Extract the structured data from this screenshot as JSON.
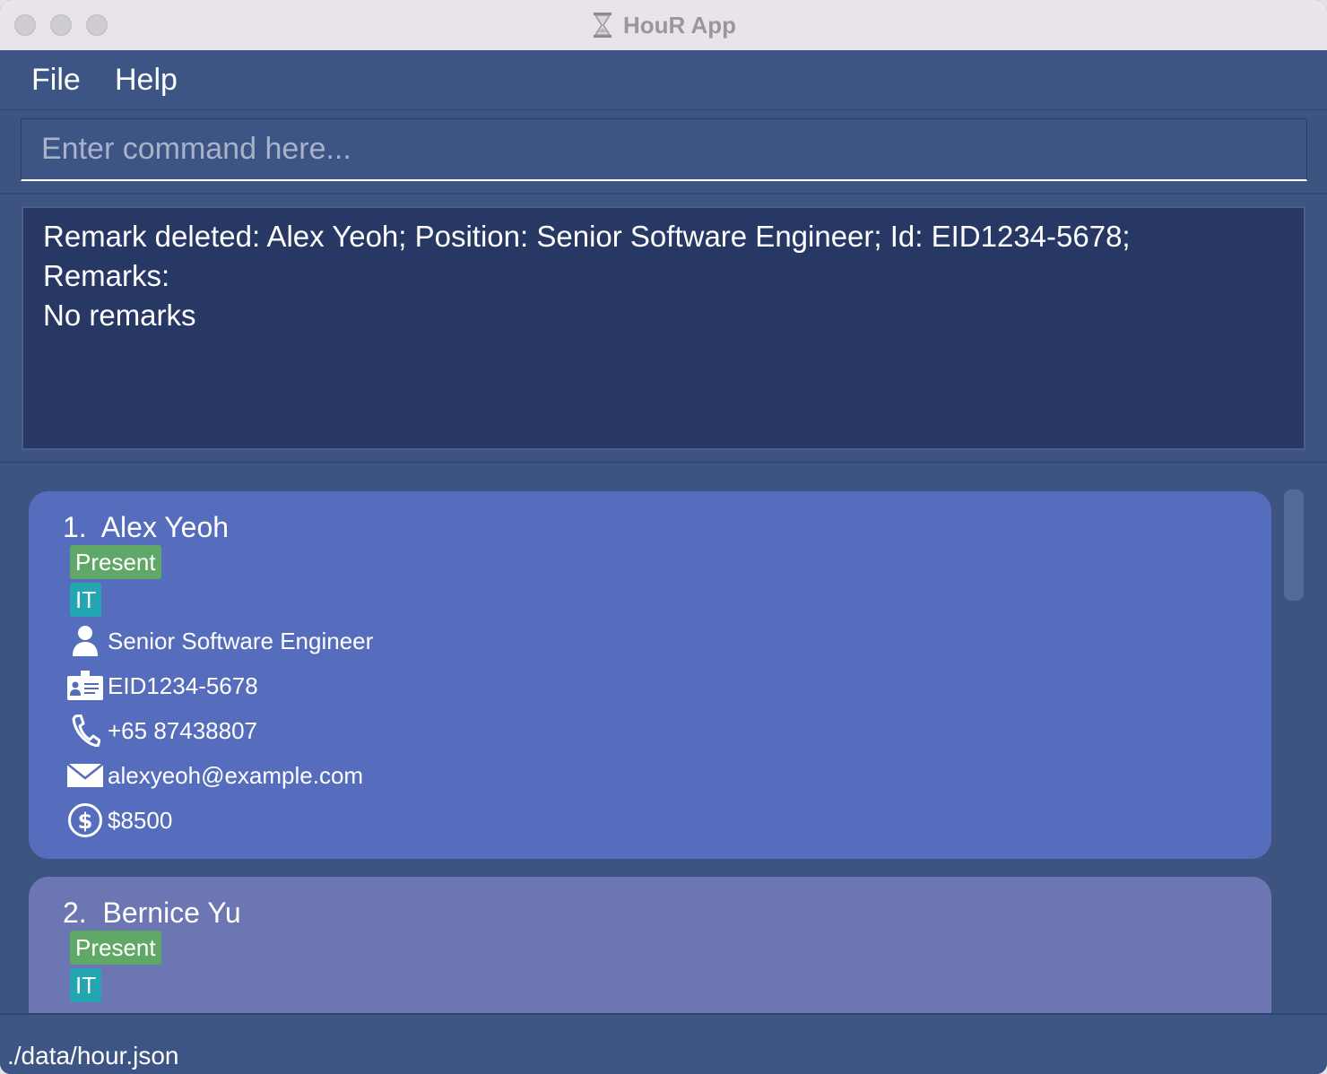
{
  "window": {
    "title": "HouR App",
    "app_icon": "hourglass-icon"
  },
  "menu": {
    "file": "File",
    "help": "Help"
  },
  "command": {
    "placeholder": "Enter command here...",
    "value": ""
  },
  "result": {
    "line1": "Remark deleted: Alex Yeoh; Position: Senior Software Engineer; Id: EID1234-5678;",
    "line2": "Remarks:",
    "line3": "No remarks"
  },
  "employees": [
    {
      "index": "1.",
      "name": "Alex Yeoh",
      "status": "Present",
      "department": "IT",
      "position": "Senior Software Engineer",
      "id": "EID1234-5678",
      "phone": "+65 87438807",
      "email": "alexyeoh@example.com",
      "salary": "$8500",
      "selected": true
    },
    {
      "index": "2.",
      "name": "Bernice Yu",
      "status": "Present",
      "department": "IT"
    }
  ],
  "status_bar": {
    "path": "./data/hour.json"
  },
  "colors": {
    "background": "#3d5481",
    "result_bg": "#283865",
    "card_selected": "#566dbd",
    "card_default": "#6c76b2",
    "tag_status": "#5fa867",
    "tag_department": "#23a6b2"
  }
}
